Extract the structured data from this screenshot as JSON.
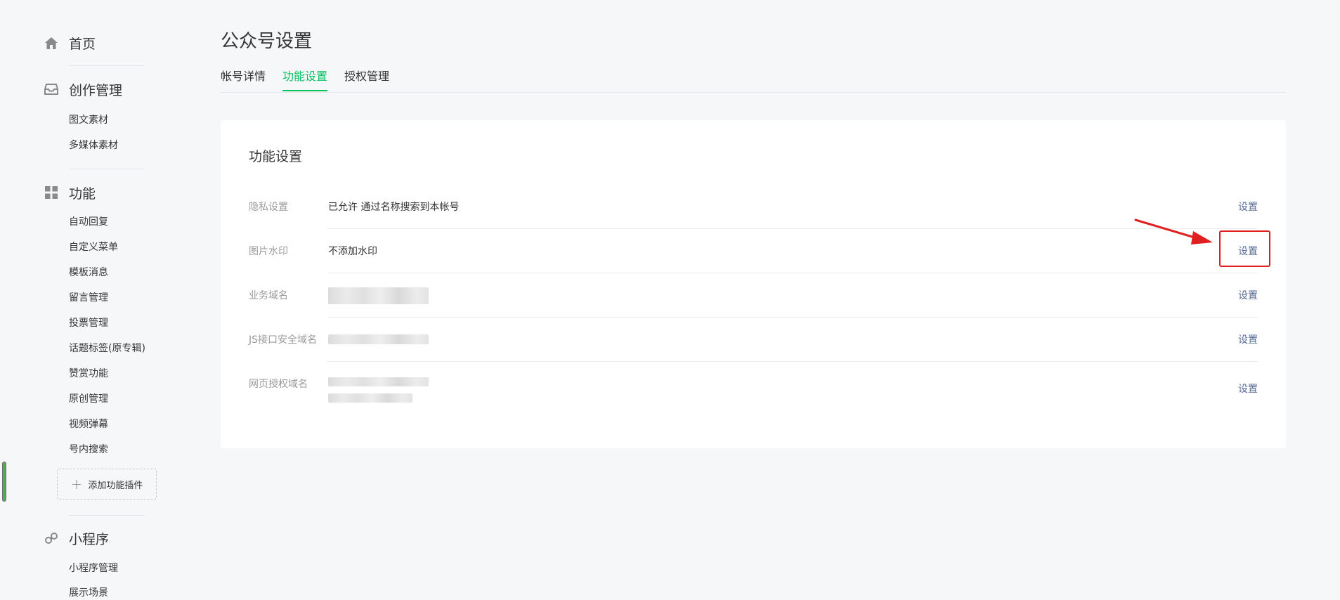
{
  "sidebar": {
    "home": {
      "label": "首页",
      "icon": "home-icon"
    },
    "creation": {
      "title": "创作管理",
      "icon": "inbox-icon",
      "items": [
        "图文素材",
        "多媒体素材"
      ]
    },
    "features": {
      "title": "功能",
      "icon": "grid-icon",
      "items": [
        "自动回复",
        "自定义菜单",
        "模板消息",
        "留言管理",
        "投票管理",
        "话题标签(原专辑)",
        "赞赏功能",
        "原创管理",
        "视频弹幕",
        "号内搜索"
      ],
      "add_plugin": "添加功能插件"
    },
    "miniprogram": {
      "title": "小程序",
      "icon": "link-icon",
      "items": [
        "小程序管理",
        "展示场景"
      ]
    }
  },
  "main": {
    "title": "公众号设置",
    "tabs": [
      {
        "label": "帐号详情",
        "active": false
      },
      {
        "label": "功能设置",
        "active": true
      },
      {
        "label": "授权管理",
        "active": false
      }
    ],
    "card": {
      "title": "功能设置",
      "rows": [
        {
          "label": "隐私设置",
          "value": "已允许 通过名称搜索到本帐号",
          "action": "设置"
        },
        {
          "label": "图片水印",
          "value": "不添加水印",
          "action": "设置"
        },
        {
          "label": "业务域名",
          "value": "",
          "action": "设置"
        },
        {
          "label": "JS接口安全域名",
          "value": "",
          "action": "设置"
        },
        {
          "label": "网页授权域名",
          "value": "",
          "action": "设置"
        }
      ]
    }
  },
  "colors": {
    "accent": "#07c160",
    "link": "#576b95",
    "annotation": "#e02020",
    "background": "#f6f7f9"
  }
}
